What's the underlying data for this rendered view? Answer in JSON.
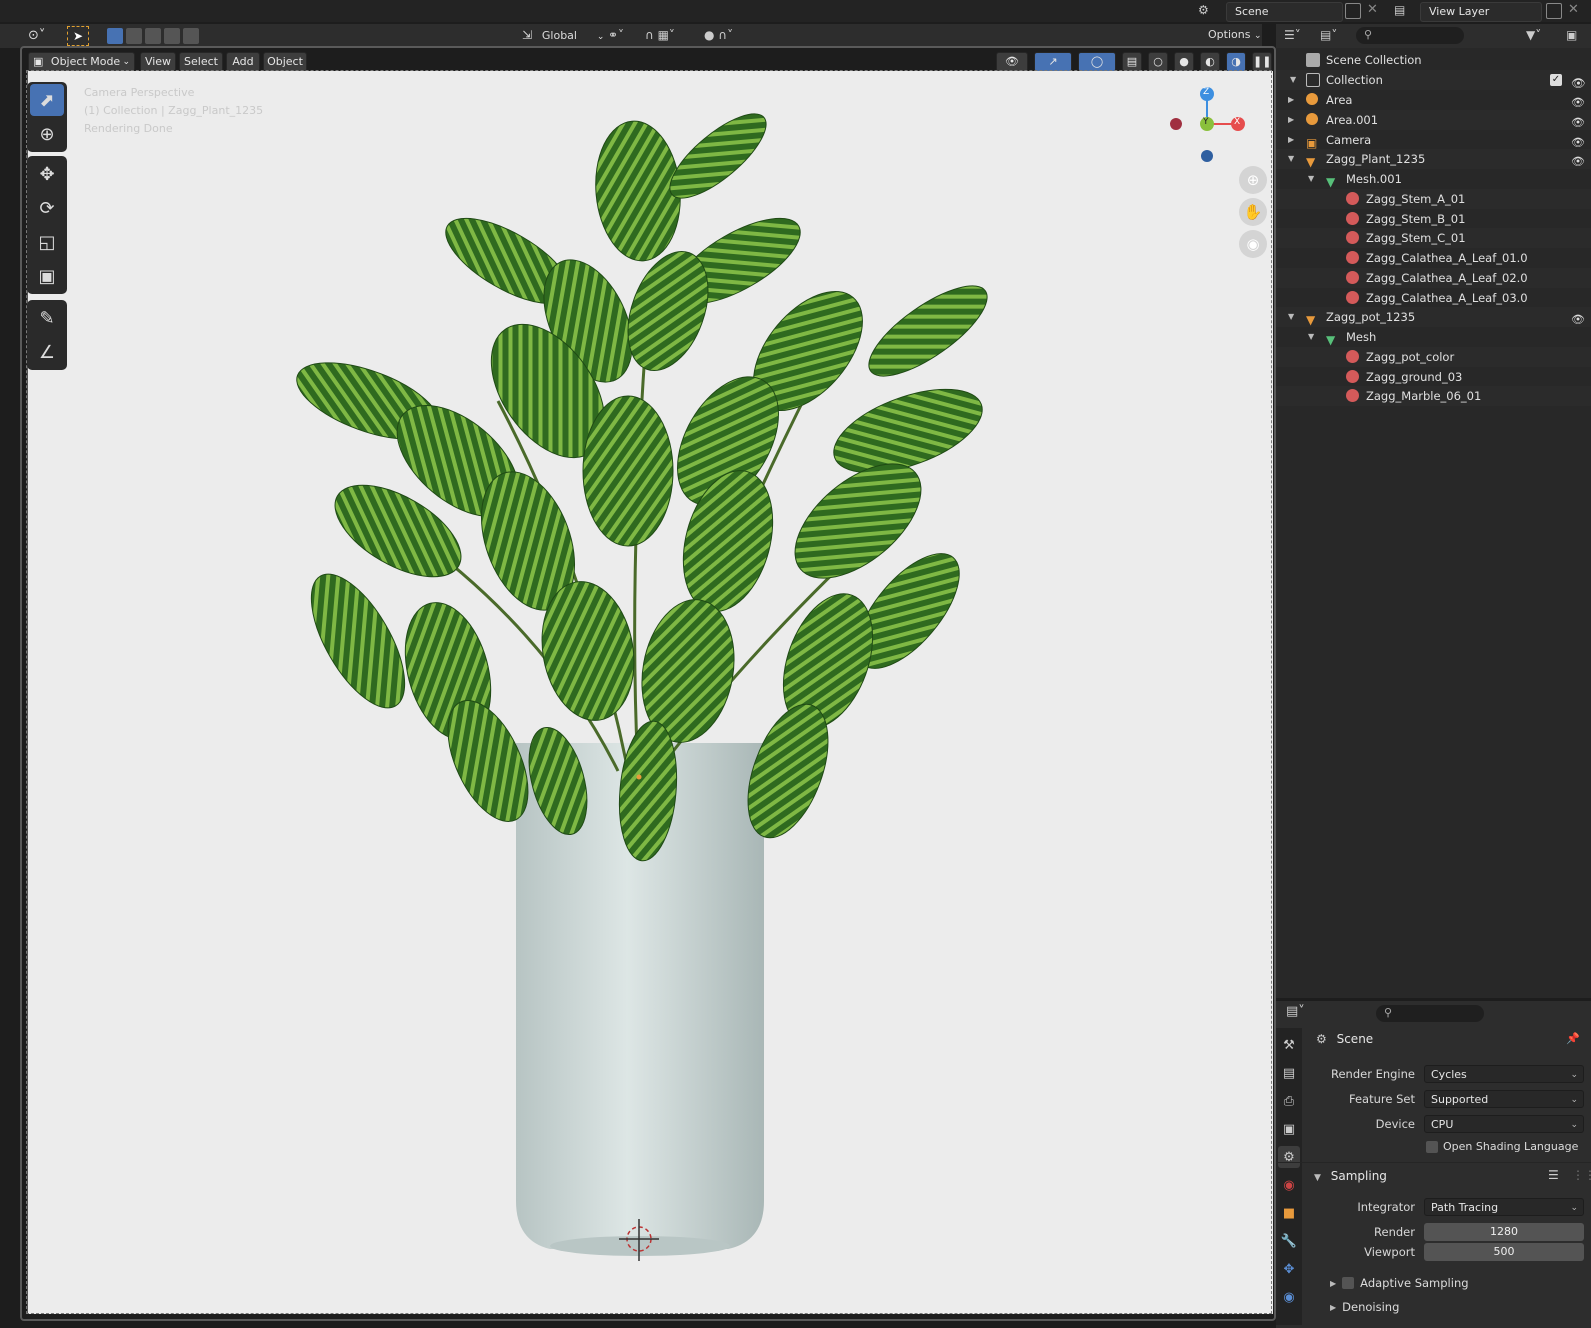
{
  "topbar": {
    "scene_label": "Scene",
    "view_layer_label": "View Layer"
  },
  "viewport_header": {
    "transform_orientation": "Global",
    "options_label": "Options",
    "mode_label": "Object Mode",
    "menus": [
      "View",
      "Select",
      "Add",
      "Object"
    ]
  },
  "viewport": {
    "overlay_lines": [
      "Camera Perspective",
      "(1) Collection | Zagg_Plant_1235",
      "Rendering Done"
    ],
    "gizmo": {
      "z": "Z",
      "y": "Y",
      "x": "X"
    }
  },
  "outliner": {
    "root": "Scene Collection",
    "collection": "Collection",
    "items": [
      {
        "label": "Area",
        "depth": 1
      },
      {
        "label": "Area.001",
        "depth": 1
      },
      {
        "label": "Camera",
        "depth": 1
      },
      {
        "label": "Zagg_Plant_1235",
        "depth": 1
      },
      {
        "label": "Mesh.001",
        "depth": 2
      },
      {
        "label": "Zagg_Stem_A_01",
        "depth": 3
      },
      {
        "label": "Zagg_Stem_B_01",
        "depth": 3
      },
      {
        "label": "Zagg_Stem_C_01",
        "depth": 3
      },
      {
        "label": "Zagg_Calathea_A_Leaf_01.0",
        "depth": 3
      },
      {
        "label": "Zagg_Calathea_A_Leaf_02.0",
        "depth": 3
      },
      {
        "label": "Zagg_Calathea_A_Leaf_03.0",
        "depth": 3
      },
      {
        "label": "Zagg_pot_1235",
        "depth": 1
      },
      {
        "label": "Mesh",
        "depth": 2
      },
      {
        "label": "Zagg_pot_color",
        "depth": 3
      },
      {
        "label": "Zagg_ground_03",
        "depth": 3
      },
      {
        "label": "Zagg_Marble_06_01",
        "depth": 3
      }
    ]
  },
  "properties": {
    "context": "Scene",
    "render_engine_label": "Render Engine",
    "render_engine": "Cycles",
    "feature_set_label": "Feature Set",
    "feature_set": "Supported",
    "device_label": "Device",
    "device": "CPU",
    "osl_label": "Open Shading Language",
    "sampling_label": "Sampling",
    "integrator_label": "Integrator",
    "integrator": "Path Tracing",
    "render_label": "Render",
    "render_samples": "1280",
    "viewport_label": "Viewport",
    "viewport_samples": "500",
    "adaptive_label": "Adaptive Sampling",
    "denoising_label": "Denoising"
  },
  "colors": {
    "accent": "#4772b3",
    "viewport_bg": "#ececec",
    "x_axis": "#e64d4d",
    "y_axis": "#8ac03c",
    "z_axis": "#3d8fe0",
    "object_orange": "#e89a3c",
    "material_red": "#d45a5a"
  }
}
